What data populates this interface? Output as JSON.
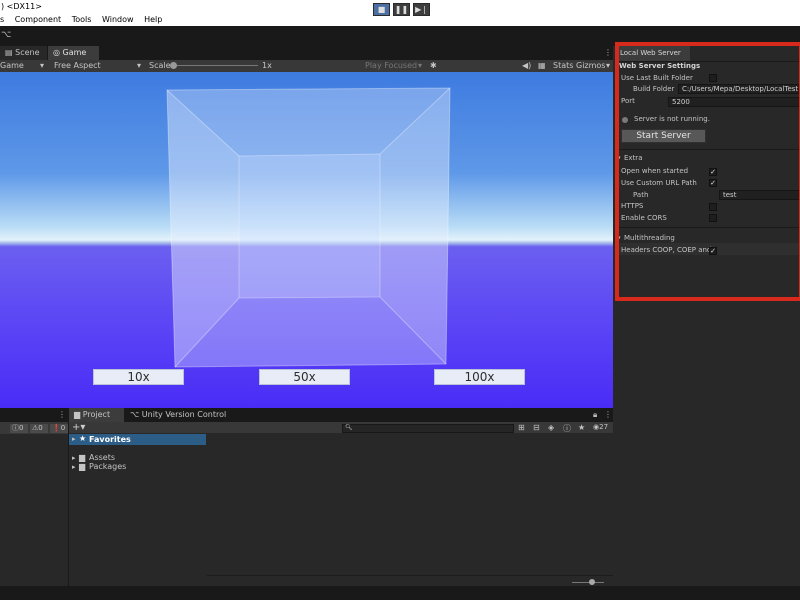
{
  "window": {
    "title": ") <DX11>"
  },
  "menu": [
    "s",
    "Component",
    "Tools",
    "Window",
    "Help"
  ],
  "tabs": {
    "scene": "Scene",
    "game": "Game"
  },
  "game_options": {
    "display": "Game",
    "aspect": "Free Aspect",
    "scale_label": "Scale",
    "scale_value": "1x",
    "play_focused": "Play Focused",
    "stats": "Stats",
    "gizmos": "Gizmos"
  },
  "viewport_buttons": [
    "10x",
    "50x",
    "100x"
  ],
  "inspector": {
    "tab": "Local Web Server",
    "header": "Web Server Settings",
    "use_last_built_folder": {
      "label": "Use Last Built Folder",
      "checked": false
    },
    "build_folder": {
      "label": "Build Folder",
      "value": "C:/Users/Mepa/Desktop/LocalTest"
    },
    "port": {
      "label": "Port",
      "value": "5200"
    },
    "status": "Server is not running.",
    "start_button": "Start Server",
    "extra": "Extra",
    "open_when_started": {
      "label": "Open when started",
      "checked": true
    },
    "use_custom_url_path": {
      "label": "Use Custom URL Path",
      "checked": true
    },
    "path": {
      "label": "Path",
      "value": "test"
    },
    "https": {
      "label": "HTTPS",
      "checked": false
    },
    "enable_cors": {
      "label": "Enable CORS",
      "checked": false
    },
    "multithreading": "Multithreading",
    "headers": {
      "label": "Headers COOP, COEP and",
      "checked": true
    }
  },
  "console": {
    "count_log": "0",
    "count_warn": "0",
    "count_error": "0"
  },
  "project": {
    "tab_project": "Project",
    "tab_uvc": "Unity Version Control",
    "favorites": "Favorites",
    "assets": "Assets",
    "packages": "Packages",
    "hidden_count": "27"
  },
  "colors": {
    "accent": "#d82a1c",
    "selection": "#2c5d87"
  }
}
